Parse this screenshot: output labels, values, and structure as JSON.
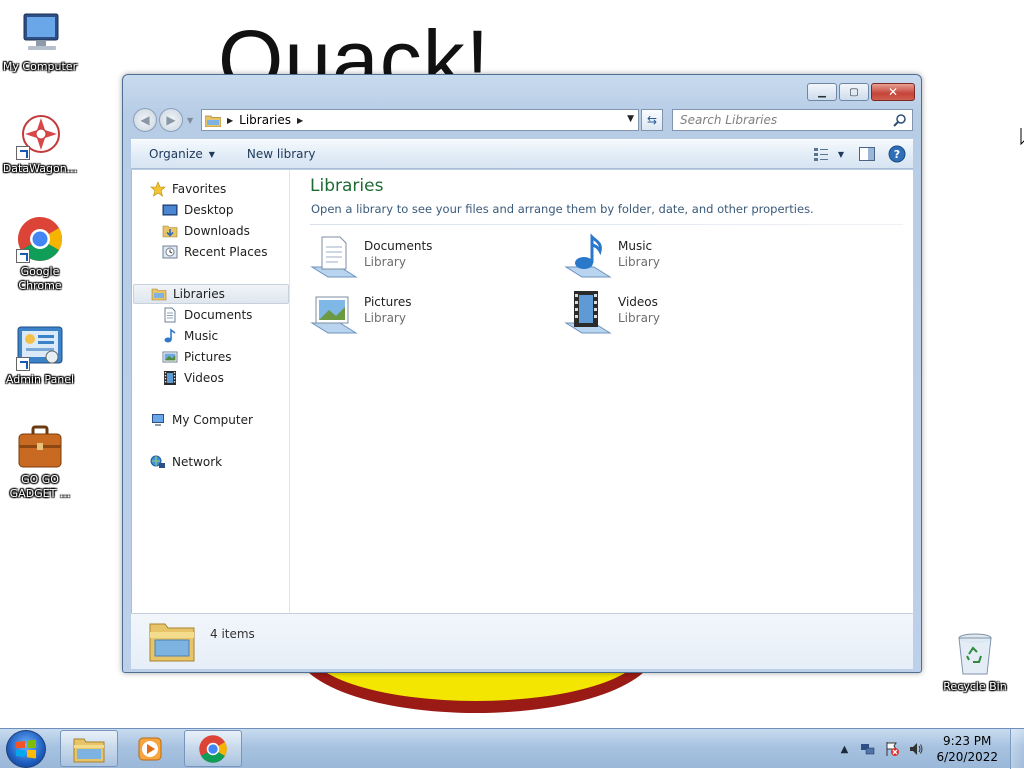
{
  "wallpaper": {
    "text": "Quack!"
  },
  "desktop_icons": [
    {
      "label": "My Computer",
      "icon": "computer-icon"
    },
    {
      "label": "DataWagon...",
      "icon": "datawagon-icon"
    },
    {
      "label": "Google Chrome",
      "icon": "chrome-icon"
    },
    {
      "label": "Admin Panel",
      "icon": "admin-panel-icon"
    },
    {
      "label": "GO GO GADGET ...",
      "icon": "briefcase-icon"
    },
    {
      "label": "Recycle Bin",
      "icon": "recycle-bin-icon"
    }
  ],
  "window": {
    "address": {
      "crumb": "Libraries"
    },
    "search": {
      "placeholder": "Search Libraries"
    },
    "toolbar": {
      "organize_label": "Organize",
      "new_library_label": "New library"
    },
    "nav_pane": {
      "favorites": {
        "label": "Favorites",
        "items": [
          "Desktop",
          "Downloads",
          "Recent Places"
        ]
      },
      "libraries": {
        "label": "Libraries",
        "items": [
          "Documents",
          "Music",
          "Pictures",
          "Videos"
        ]
      },
      "computer_label": "My Computer",
      "network_label": "Network"
    },
    "main": {
      "title": "Libraries",
      "subtitle": "Open a library to see your files and arrange them by folder, date, and other properties.",
      "libraries": [
        {
          "name": "Documents",
          "type": "Library",
          "icon": "documents-library-icon"
        },
        {
          "name": "Music",
          "type": "Library",
          "icon": "music-library-icon"
        },
        {
          "name": "Pictures",
          "type": "Library",
          "icon": "pictures-library-icon"
        },
        {
          "name": "Videos",
          "type": "Library",
          "icon": "videos-library-icon"
        }
      ]
    },
    "details": {
      "count": "4 items"
    }
  },
  "taskbar": {
    "clock": {
      "time": "9:23 PM",
      "date": "6/20/2022"
    },
    "tasks": [
      "file-explorer-icon",
      "media-player-icon",
      "chrome-icon"
    ]
  },
  "colors": {
    "title_green": "#1e6b32",
    "taskbar": "#a7c2e0",
    "selection": "#dfe6ee"
  }
}
